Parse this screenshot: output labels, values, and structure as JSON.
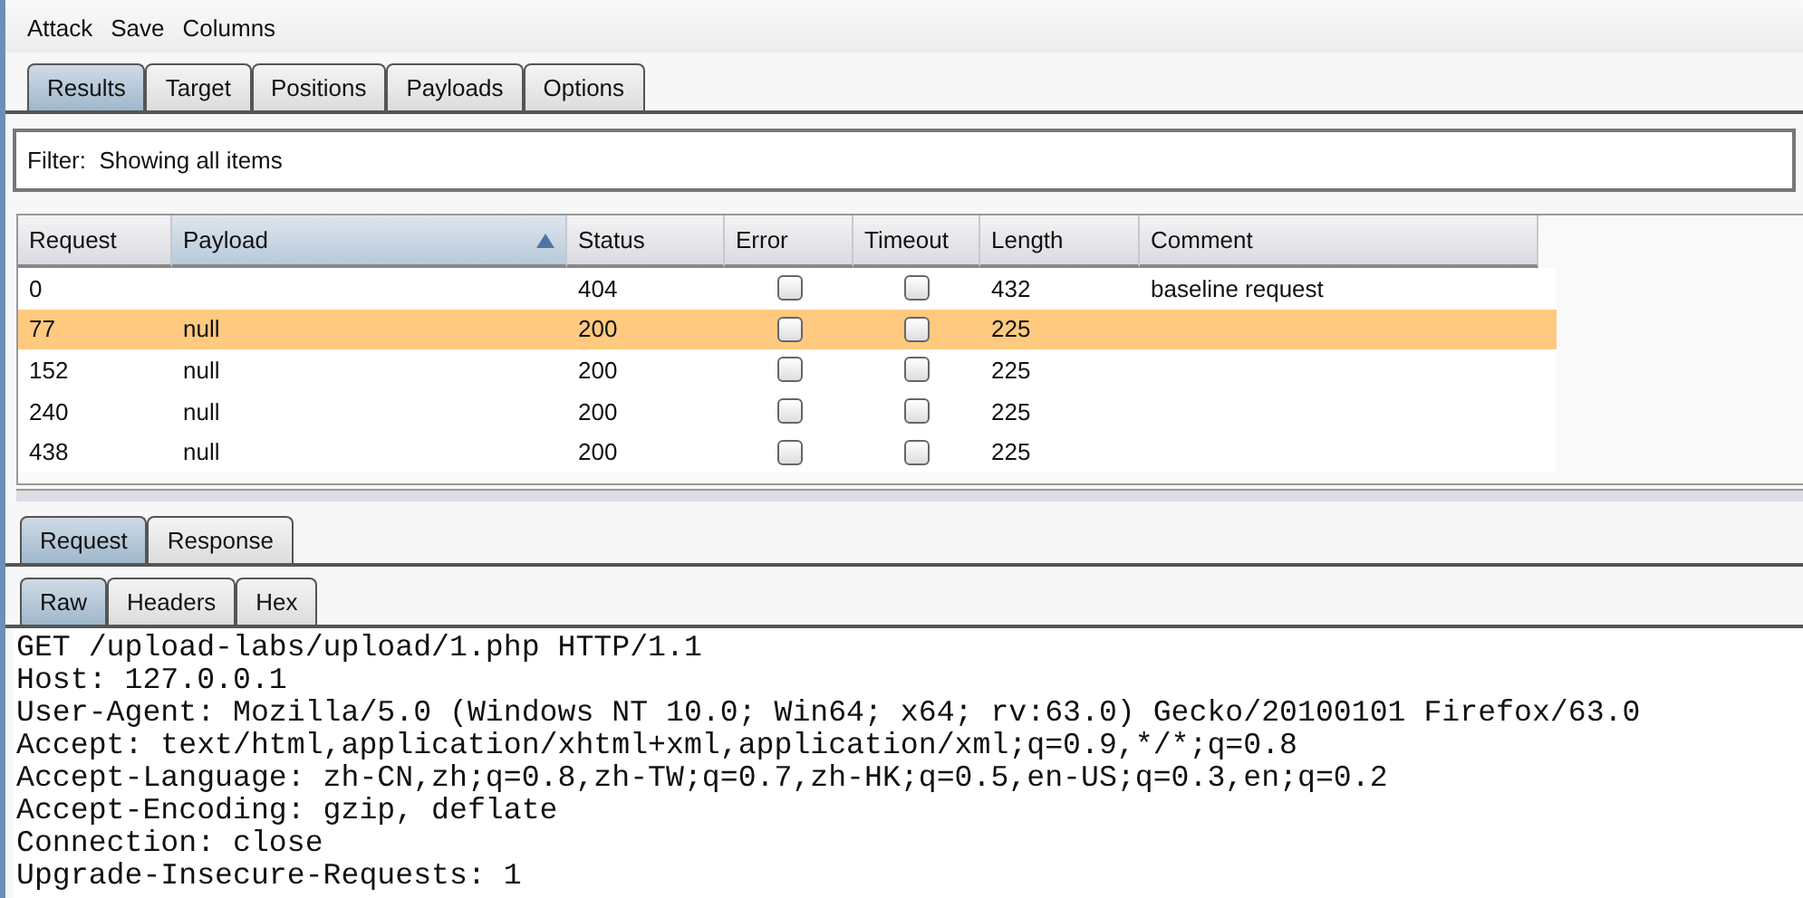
{
  "menu": [
    "Attack",
    "Save",
    "Columns"
  ],
  "tabs": [
    {
      "label": "Results",
      "selected": true
    },
    {
      "label": "Target",
      "selected": false
    },
    {
      "label": "Positions",
      "selected": false
    },
    {
      "label": "Payloads",
      "selected": false
    },
    {
      "label": "Options",
      "selected": false
    }
  ],
  "filter": "Filter:  Showing all items",
  "table": {
    "columns": [
      {
        "label": "Request",
        "sorted": false
      },
      {
        "label": "Payload",
        "sorted": true
      },
      {
        "label": "Status",
        "sorted": false
      },
      {
        "label": "Error",
        "sorted": false
      },
      {
        "label": "Timeout",
        "sorted": false
      },
      {
        "label": "Length",
        "sorted": false
      },
      {
        "label": "Comment",
        "sorted": false
      }
    ],
    "rows": [
      {
        "request": "0",
        "payload": "",
        "status": "404",
        "error": false,
        "timeout": false,
        "length": "432",
        "comment": "baseline request",
        "selected": false
      },
      {
        "request": "77",
        "payload": "null",
        "status": "200",
        "error": false,
        "timeout": false,
        "length": "225",
        "comment": "",
        "selected": true
      },
      {
        "request": "152",
        "payload": "null",
        "status": "200",
        "error": false,
        "timeout": false,
        "length": "225",
        "comment": "",
        "selected": false
      },
      {
        "request": "240",
        "payload": "null",
        "status": "200",
        "error": false,
        "timeout": false,
        "length": "225",
        "comment": "",
        "selected": false
      },
      {
        "request": "438",
        "payload": "null",
        "status": "200",
        "error": false,
        "timeout": false,
        "length": "225",
        "comment": "",
        "selected": false
      }
    ]
  },
  "message_tabs": [
    {
      "label": "Request",
      "selected": true
    },
    {
      "label": "Response",
      "selected": false
    }
  ],
  "view_tabs": [
    {
      "label": "Raw",
      "selected": true
    },
    {
      "label": "Headers",
      "selected": false
    },
    {
      "label": "Hex",
      "selected": false
    }
  ],
  "raw_lines": [
    "GET /upload-labs/upload/1.php HTTP/1.1",
    "Host: 127.0.0.1",
    "User-Agent: Mozilla/5.0 (Windows NT 10.0; Win64; x64; rv:63.0) Gecko/20100101 Firefox/63.0",
    "Accept: text/html,application/xhtml+xml,application/xml;q=0.9,*/*;q=0.8",
    "Accept-Language: zh-CN,zh;q=0.8,zh-TW;q=0.7,zh-HK;q=0.5,en-US;q=0.3,en;q=0.2",
    "Accept-Encoding: gzip, deflate",
    "Connection: close",
    "Upgrade-Insecure-Requests: 1"
  ]
}
